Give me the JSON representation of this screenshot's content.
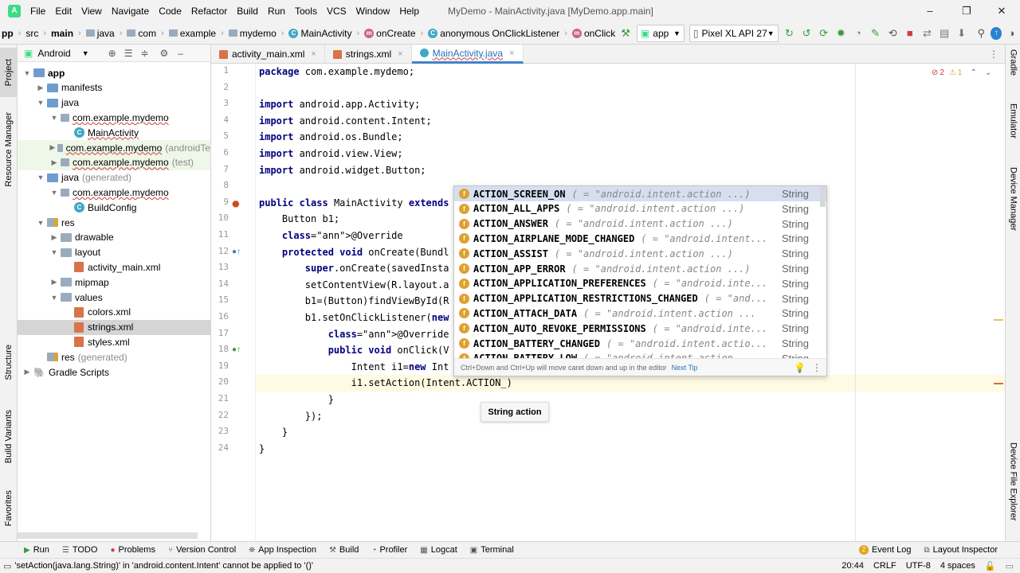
{
  "window": {
    "title": "MyDemo - MainActivity.java [MyDemo.app.main]",
    "minimize": "–",
    "maximize": "❐",
    "close": "✕"
  },
  "menu": [
    "File",
    "Edit",
    "View",
    "Navigate",
    "Code",
    "Refactor",
    "Build",
    "Run",
    "Tools",
    "VCS",
    "Window",
    "Help"
  ],
  "breadcrumb": {
    "items": [
      "pp",
      "src",
      "main",
      "java",
      "com",
      "example",
      "mydemo",
      "MainActivity",
      "onCreate",
      "anonymous OnClickListener",
      "onClick"
    ],
    "run_config": "app",
    "device": "Pixel XL API 27"
  },
  "project": {
    "view_mode": "Android",
    "tree": [
      {
        "label": "app",
        "indent": 0,
        "arrow": "▼",
        "icon": "folder-blue"
      },
      {
        "label": "manifests",
        "indent": 1,
        "arrow": "▶",
        "icon": "folder-blue"
      },
      {
        "label": "java",
        "indent": 1,
        "arrow": "▼",
        "icon": "folder-blue"
      },
      {
        "label": "com.example.mydemo",
        "indent": 2,
        "arrow": "▼",
        "icon": "package"
      },
      {
        "label": "MainActivity",
        "indent": 3,
        "arrow": "",
        "icon": "class"
      },
      {
        "label": "com.example.mydemo",
        "suffix": "(androidTe",
        "indent": 2,
        "arrow": "▶",
        "icon": "package"
      },
      {
        "label": "com.example.mydemo",
        "suffix": "(test)",
        "indent": 2,
        "arrow": "▶",
        "icon": "package"
      },
      {
        "label": "java",
        "suffix": "(generated)",
        "indent": 1,
        "arrow": "▼",
        "icon": "folder-blue"
      },
      {
        "label": "com.example.mydemo",
        "indent": 2,
        "arrow": "▼",
        "icon": "package"
      },
      {
        "label": "BuildConfig",
        "indent": 3,
        "arrow": "",
        "icon": "class"
      },
      {
        "label": "res",
        "indent": 1,
        "arrow": "▼",
        "icon": "folder-res"
      },
      {
        "label": "drawable",
        "indent": 2,
        "arrow": "▶",
        "icon": "folder"
      },
      {
        "label": "layout",
        "indent": 2,
        "arrow": "▼",
        "icon": "folder"
      },
      {
        "label": "activity_main.xml",
        "indent": 3,
        "arrow": "",
        "icon": "xml"
      },
      {
        "label": "mipmap",
        "indent": 2,
        "arrow": "▶",
        "icon": "folder"
      },
      {
        "label": "values",
        "indent": 2,
        "arrow": "▼",
        "icon": "folder"
      },
      {
        "label": "colors.xml",
        "indent": 3,
        "arrow": "",
        "icon": "xml"
      },
      {
        "label": "strings.xml",
        "indent": 3,
        "arrow": "",
        "icon": "xml"
      },
      {
        "label": "styles.xml",
        "indent": 3,
        "arrow": "",
        "icon": "xml"
      },
      {
        "label": "res",
        "suffix": "(generated)",
        "indent": 1,
        "arrow": "",
        "icon": "folder-res"
      },
      {
        "label": "Gradle Scripts",
        "indent": 0,
        "arrow": "▶",
        "icon": "gradle"
      }
    ]
  },
  "tabs": [
    {
      "label": "activity_main.xml",
      "active": false
    },
    {
      "label": "strings.xml",
      "active": false
    },
    {
      "label": "MainActivity.java",
      "active": true
    }
  ],
  "editor": {
    "lines": [
      "package com.example.mydemo;",
      "",
      "import android.app.Activity;",
      "import android.content.Intent;",
      "import android.os.Bundle;",
      "import android.view.View;",
      "import android.widget.Button;",
      "",
      "public class MainActivity extends",
      "    Button b1;",
      "    @Override",
      "    protected void onCreate(Bundl",
      "        super.onCreate(savedInsta",
      "        setContentView(R.layout.a",
      "        b1=(Button)findViewById(R",
      "        b1.setOnClickListener(new",
      "            @Override",
      "            public void onClick(V",
      "                Intent i1=new Int",
      "                i1.setAction(Intent.ACTION_)",
      "            }",
      "        });",
      "    }",
      "}"
    ],
    "inspection": {
      "errors": "2",
      "warnings": "1"
    }
  },
  "completion": {
    "items": [
      {
        "name": "ACTION_SCREEN_ON",
        "value": "( = \"android.intent.action ...)",
        "type": "String"
      },
      {
        "name": "ACTION_ALL_APPS",
        "value": "( = \"android.intent.action ...)",
        "type": "String"
      },
      {
        "name": "ACTION_ANSWER",
        "value": "( = \"android.intent.action ...)",
        "type": "String"
      },
      {
        "name": "ACTION_AIRPLANE_MODE_CHANGED",
        "value": "( = \"android.intent...",
        "type": "String"
      },
      {
        "name": "ACTION_ASSIST",
        "value": "( = \"android.intent.action ...)",
        "type": "String"
      },
      {
        "name": "ACTION_APP_ERROR",
        "value": "( = \"android.intent.action ...)",
        "type": "String"
      },
      {
        "name": "ACTION_APPLICATION_PREFERENCES",
        "value": "( = \"android.inte...",
        "type": "String"
      },
      {
        "name": "ACTION_APPLICATION_RESTRICTIONS_CHANGED",
        "value": "( = \"and...",
        "type": "String"
      },
      {
        "name": "ACTION_ATTACH_DATA",
        "value": "( = \"android.intent.action ...",
        "type": "String"
      },
      {
        "name": "ACTION_AUTO_REVOKE_PERMISSIONS",
        "value": "( = \"android.inte...",
        "type": "String"
      },
      {
        "name": "ACTION_BATTERY_CHANGED",
        "value": "( = \"android.intent.actio...",
        "type": "String"
      },
      {
        "name": "ACTION_BATTERY_LOW",
        "value": "( = \"android.intent.action",
        "type": "String"
      }
    ],
    "footer": "Ctrl+Down and Ctrl+Up will move caret down and up in the editor",
    "footer_link": "Next Tip"
  },
  "param_hint": "String action",
  "left_tools": [
    "Project",
    "Resource Manager",
    "Structure",
    "Build Variants",
    "Favorites"
  ],
  "right_tools": [
    "Gradle",
    "Emulator",
    "Device Manager",
    "Device File Explorer"
  ],
  "bottom_tools": [
    "Run",
    "TODO",
    "Problems",
    "Version Control",
    "App Inspection",
    "Build",
    "Profiler",
    "Logcat",
    "Terminal"
  ],
  "bottom_right_tools": [
    "Event Log",
    "Layout Inspector"
  ],
  "event_log_count": "2",
  "status": {
    "message": "'setAction(java.lang.String)' in 'android.content.Intent' cannot be applied to '()'",
    "position": "20:44",
    "line_sep": "CRLF",
    "encoding": "UTF-8",
    "indent": "4 spaces"
  }
}
